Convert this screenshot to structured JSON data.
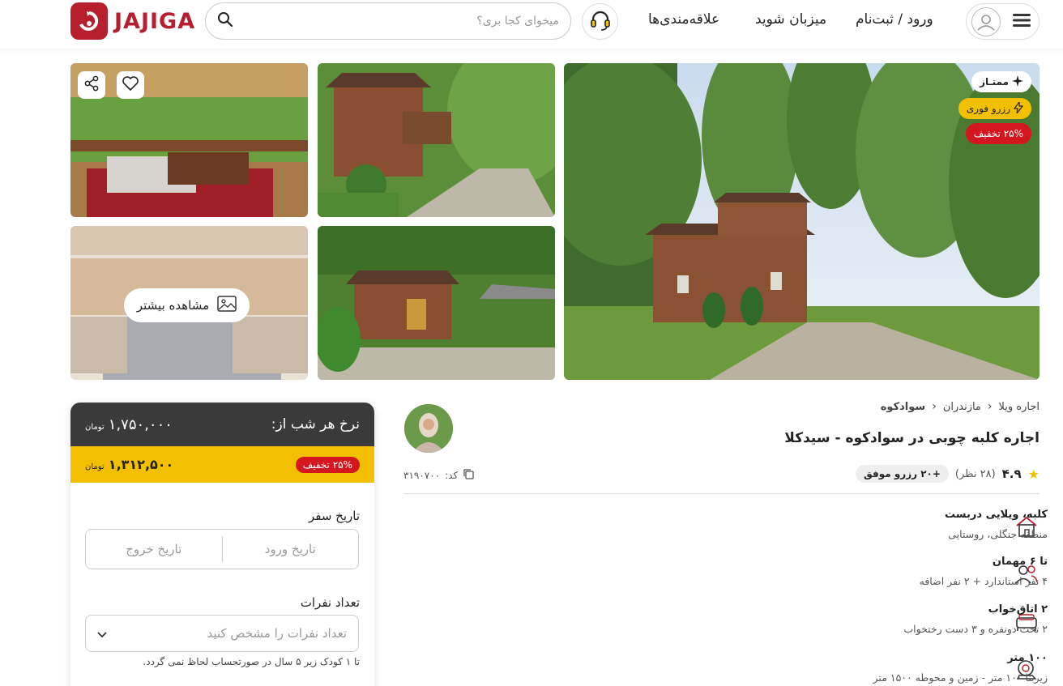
{
  "header": {
    "logo_text": "JAJIGA",
    "login_label": "ورود / ثبت‌نام",
    "host_label": "میزبان شوید",
    "favorites_label": "علاقه‌مندی‌ها",
    "search_placeholder": "میخوای کجا بری؟"
  },
  "gallery": {
    "badges": {
      "premium": "ممتـاز",
      "instant": "رزرو فوری",
      "discount": "۲۵% تخفیف"
    },
    "see_more_label": "مشاهده بیشتر"
  },
  "booking": {
    "nightly_label": "نرخ هر شب از:",
    "original_price": "۱,۷۵۰,۰۰۰",
    "currency": "تومان",
    "discount_badge": "۲۵% تخفیف",
    "discounted_price": "۱,۳۱۲,۵۰۰",
    "trip_date_label": "تاریخ سفر",
    "checkin_placeholder": "تاریخ ورود",
    "checkout_placeholder": "تاریخ خروج",
    "guests_label": "تعداد نفرات",
    "guests_placeholder": "تعداد نفرات را مشخص کنید",
    "guests_note": "تا ۱ کودک زیر ۵ سال در صورتحساب لحاظ نمی گردد."
  },
  "listing": {
    "breadcrumb": [
      "اجاره ویلا",
      "مازندران",
      "سوادکوه"
    ],
    "title": "اجاره کلبه چوبی در سوادکوه - سیدکلا",
    "rating": "۴.۹",
    "reviews": "(۲۸ نظر)",
    "bookings_badge": "+۲۰ رزرو موفق",
    "code_label": "کد:",
    "code_value": "۳۱۹۰۷۰۰",
    "features": [
      {
        "icon": "house-icon",
        "title": "کلبه، ویلایی دربست",
        "sub": "منطقه جنگلی، روستایی"
      },
      {
        "icon": "guests-icon",
        "title": "تا ۶ مهمان",
        "sub": "۴ نفر استاندارد + ۲ نفر اضافه"
      },
      {
        "icon": "bed-icon",
        "title": "۲ اتاق‌خواب",
        "sub": "۲ تخت دونفره و ۳ دست رختخواب"
      },
      {
        "icon": "area-icon",
        "title": "۱۰۰ متر",
        "sub": "زیربنا ۱۰۰ متر - زمین و محوطه ۱۵۰۰ متر"
      }
    ]
  },
  "colors": {
    "brand": "#b51f2e",
    "discount_yellow": "#f2c000",
    "card_dark": "#3a3a3a",
    "badge_red": "#d4161e"
  }
}
